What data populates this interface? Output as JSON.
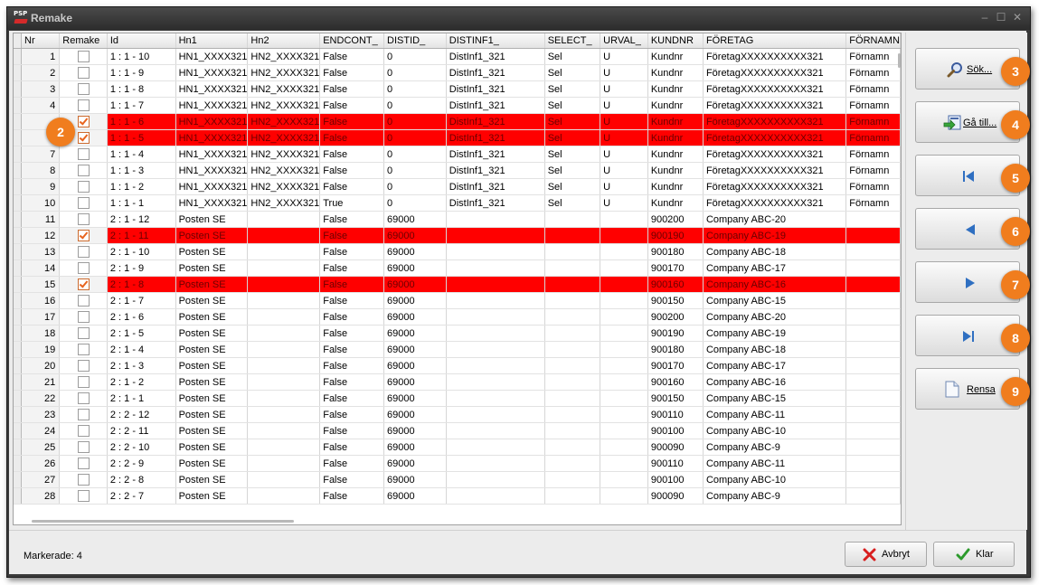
{
  "window": {
    "title": "Remake",
    "app_icon_text": "PSP"
  },
  "grid": {
    "columns": [
      {
        "key": "nr",
        "label": "Nr"
      },
      {
        "key": "remake",
        "label": "Remake"
      },
      {
        "key": "id",
        "label": "Id"
      },
      {
        "key": "hn1",
        "label": "Hn1"
      },
      {
        "key": "hn2",
        "label": "Hn2"
      },
      {
        "key": "endcont",
        "label": "ENDCONT_"
      },
      {
        "key": "distid",
        "label": "DISTID_"
      },
      {
        "key": "distinf1",
        "label": "DISTINF1_"
      },
      {
        "key": "select",
        "label": "SELECT_"
      },
      {
        "key": "urval",
        "label": "URVAL_"
      },
      {
        "key": "kundnr",
        "label": "KUNDNR"
      },
      {
        "key": "foretag",
        "label": "FÖRETAG"
      },
      {
        "key": "fornamn",
        "label": "FÖRNAMN"
      }
    ],
    "rows": [
      {
        "nr": "1",
        "remake": false,
        "id": "1 : 1 - 10",
        "hn1": "HN1_XXXX321",
        "hn2": "HN2_XXXX321",
        "endcont": "False",
        "distid": "0",
        "distinf1": "DistInf1_321",
        "select": "Sel",
        "urval": "U",
        "kundnr": "Kundnr",
        "foretag": "FöretagXXXXXXXXXX321",
        "fornamn": "Förnamn"
      },
      {
        "nr": "2",
        "remake": false,
        "id": "1 : 1 - 9",
        "hn1": "HN1_XXXX321",
        "hn2": "HN2_XXXX321",
        "endcont": "False",
        "distid": "0",
        "distinf1": "DistInf1_321",
        "select": "Sel",
        "urval": "U",
        "kundnr": "Kundnr",
        "foretag": "FöretagXXXXXXXXXX321",
        "fornamn": "Förnamn"
      },
      {
        "nr": "3",
        "remake": false,
        "id": "1 : 1 - 8",
        "hn1": "HN1_XXXX321",
        "hn2": "HN2_XXXX321",
        "endcont": "False",
        "distid": "0",
        "distinf1": "DistInf1_321",
        "select": "Sel",
        "urval": "U",
        "kundnr": "Kundnr",
        "foretag": "FöretagXXXXXXXXXX321",
        "fornamn": "Förnamn"
      },
      {
        "nr": "4",
        "remake": false,
        "id": "1 : 1 - 7",
        "hn1": "HN1_XXXX321",
        "hn2": "HN2_XXXX321",
        "endcont": "False",
        "distid": "0",
        "distinf1": "DistInf1_321",
        "select": "Sel",
        "urval": "U",
        "kundnr": "Kundnr",
        "foretag": "FöretagXXXXXXXXXX321",
        "fornamn": "Förnamn"
      },
      {
        "nr": "",
        "remake": true,
        "id": "1 : 1 - 6",
        "hn1": "HN1_XXXX321",
        "hn2": "HN2_XXXX321",
        "endcont": "False",
        "distid": "0",
        "distinf1": "DistInf1_321",
        "select": "Sel",
        "urval": "U",
        "kundnr": "Kundnr",
        "foretag": "FöretagXXXXXXXXXX321",
        "fornamn": "Förnamn"
      },
      {
        "nr": "",
        "remake": true,
        "id": "1 : 1 - 5",
        "hn1": "HN1_XXXX321",
        "hn2": "HN2_XXXX321",
        "endcont": "False",
        "distid": "0",
        "distinf1": "DistInf1_321",
        "select": "Sel",
        "urval": "U",
        "kundnr": "Kundnr",
        "foretag": "FöretagXXXXXXXXXX321",
        "fornamn": "Förnamn"
      },
      {
        "nr": "7",
        "remake": false,
        "id": "1 : 1 - 4",
        "hn1": "HN1_XXXX321",
        "hn2": "HN2_XXXX321",
        "endcont": "False",
        "distid": "0",
        "distinf1": "DistInf1_321",
        "select": "Sel",
        "urval": "U",
        "kundnr": "Kundnr",
        "foretag": "FöretagXXXXXXXXXX321",
        "fornamn": "Förnamn"
      },
      {
        "nr": "8",
        "remake": false,
        "id": "1 : 1 - 3",
        "hn1": "HN1_XXXX321",
        "hn2": "HN2_XXXX321",
        "endcont": "False",
        "distid": "0",
        "distinf1": "DistInf1_321",
        "select": "Sel",
        "urval": "U",
        "kundnr": "Kundnr",
        "foretag": "FöretagXXXXXXXXXX321",
        "fornamn": "Förnamn"
      },
      {
        "nr": "9",
        "remake": false,
        "id": "1 : 1 - 2",
        "hn1": "HN1_XXXX321",
        "hn2": "HN2_XXXX321",
        "endcont": "False",
        "distid": "0",
        "distinf1": "DistInf1_321",
        "select": "Sel",
        "urval": "U",
        "kundnr": "Kundnr",
        "foretag": "FöretagXXXXXXXXXX321",
        "fornamn": "Förnamn"
      },
      {
        "nr": "10",
        "remake": false,
        "id": "1 : 1 - 1",
        "hn1": "HN1_XXXX321",
        "hn2": "HN2_XXXX321",
        "endcont": "True",
        "distid": "0",
        "distinf1": "DistInf1_321",
        "select": "Sel",
        "urval": "U",
        "kundnr": "Kundnr",
        "foretag": "FöretagXXXXXXXXXX321",
        "fornamn": "Förnamn"
      },
      {
        "nr": "11",
        "remake": false,
        "id": "2 : 1 - 12",
        "hn1": "Posten SE",
        "hn2": "",
        "endcont": "False",
        "distid": "69000",
        "distinf1": "",
        "select": "",
        "urval": "",
        "kundnr": "900200",
        "foretag": "Company  ABC-20",
        "fornamn": ""
      },
      {
        "nr": "12",
        "remake": true,
        "id": "2 : 1 - 11",
        "hn1": "Posten SE",
        "hn2": "",
        "endcont": "False",
        "distid": "69000",
        "distinf1": "",
        "select": "",
        "urval": "",
        "kundnr": "900190",
        "foretag": "Company  ABC-19",
        "fornamn": ""
      },
      {
        "nr": "13",
        "remake": false,
        "id": "2 : 1 - 10",
        "hn1": "Posten SE",
        "hn2": "",
        "endcont": "False",
        "distid": "69000",
        "distinf1": "",
        "select": "",
        "urval": "",
        "kundnr": "900180",
        "foretag": "Company  ABC-18",
        "fornamn": ""
      },
      {
        "nr": "14",
        "remake": false,
        "id": "2 : 1 - 9",
        "hn1": "Posten SE",
        "hn2": "",
        "endcont": "False",
        "distid": "69000",
        "distinf1": "",
        "select": "",
        "urval": "",
        "kundnr": "900170",
        "foretag": "Company  ABC-17",
        "fornamn": ""
      },
      {
        "nr": "15",
        "remake": true,
        "id": "2 : 1 - 8",
        "hn1": "Posten SE",
        "hn2": "",
        "endcont": "False",
        "distid": "69000",
        "distinf1": "",
        "select": "",
        "urval": "",
        "kundnr": "900160",
        "foretag": "Company  ABC-16",
        "fornamn": ""
      },
      {
        "nr": "16",
        "remake": false,
        "id": "2 : 1 - 7",
        "hn1": "Posten SE",
        "hn2": "",
        "endcont": "False",
        "distid": "69000",
        "distinf1": "",
        "select": "",
        "urval": "",
        "kundnr": "900150",
        "foretag": "Company  ABC-15",
        "fornamn": ""
      },
      {
        "nr": "17",
        "remake": false,
        "id": "2 : 1 - 6",
        "hn1": "Posten SE",
        "hn2": "",
        "endcont": "False",
        "distid": "69000",
        "distinf1": "",
        "select": "",
        "urval": "",
        "kundnr": "900200",
        "foretag": "Company  ABC-20",
        "fornamn": ""
      },
      {
        "nr": "18",
        "remake": false,
        "id": "2 : 1 - 5",
        "hn1": "Posten SE",
        "hn2": "",
        "endcont": "False",
        "distid": "69000",
        "distinf1": "",
        "select": "",
        "urval": "",
        "kundnr": "900190",
        "foretag": "Company  ABC-19",
        "fornamn": ""
      },
      {
        "nr": "19",
        "remake": false,
        "id": "2 : 1 - 4",
        "hn1": "Posten SE",
        "hn2": "",
        "endcont": "False",
        "distid": "69000",
        "distinf1": "",
        "select": "",
        "urval": "",
        "kundnr": "900180",
        "foretag": "Company  ABC-18",
        "fornamn": ""
      },
      {
        "nr": "20",
        "remake": false,
        "id": "2 : 1 - 3",
        "hn1": "Posten SE",
        "hn2": "",
        "endcont": "False",
        "distid": "69000",
        "distinf1": "",
        "select": "",
        "urval": "",
        "kundnr": "900170",
        "foretag": "Company  ABC-17",
        "fornamn": ""
      },
      {
        "nr": "21",
        "remake": false,
        "id": "2 : 1 - 2",
        "hn1": "Posten SE",
        "hn2": "",
        "endcont": "False",
        "distid": "69000",
        "distinf1": "",
        "select": "",
        "urval": "",
        "kundnr": "900160",
        "foretag": "Company  ABC-16",
        "fornamn": ""
      },
      {
        "nr": "22",
        "remake": false,
        "id": "2 : 1 - 1",
        "hn1": "Posten SE",
        "hn2": "",
        "endcont": "False",
        "distid": "69000",
        "distinf1": "",
        "select": "",
        "urval": "",
        "kundnr": "900150",
        "foretag": "Company  ABC-15",
        "fornamn": ""
      },
      {
        "nr": "23",
        "remake": false,
        "id": "2 : 2 - 12",
        "hn1": "Posten SE",
        "hn2": "",
        "endcont": "False",
        "distid": "69000",
        "distinf1": "",
        "select": "",
        "urval": "",
        "kundnr": "900110",
        "foretag": "Company  ABC-11",
        "fornamn": ""
      },
      {
        "nr": "24",
        "remake": false,
        "id": "2 : 2 - 11",
        "hn1": "Posten SE",
        "hn2": "",
        "endcont": "False",
        "distid": "69000",
        "distinf1": "",
        "select": "",
        "urval": "",
        "kundnr": "900100",
        "foretag": "Company  ABC-10",
        "fornamn": ""
      },
      {
        "nr": "25",
        "remake": false,
        "id": "2 : 2 - 10",
        "hn1": "Posten SE",
        "hn2": "",
        "endcont": "False",
        "distid": "69000",
        "distinf1": "",
        "select": "",
        "urval": "",
        "kundnr": "900090",
        "foretag": "Company  ABC-9",
        "fornamn": ""
      },
      {
        "nr": "26",
        "remake": false,
        "id": "2 : 2 - 9",
        "hn1": "Posten SE",
        "hn2": "",
        "endcont": "False",
        "distid": "69000",
        "distinf1": "",
        "select": "",
        "urval": "",
        "kundnr": "900110",
        "foretag": "Company  ABC-11",
        "fornamn": ""
      },
      {
        "nr": "27",
        "remake": false,
        "id": "2 : 2 - 8",
        "hn1": "Posten SE",
        "hn2": "",
        "endcont": "False",
        "distid": "69000",
        "distinf1": "",
        "select": "",
        "urval": "",
        "kundnr": "900100",
        "foretag": "Company  ABC-10",
        "fornamn": ""
      },
      {
        "nr": "28",
        "remake": false,
        "id": "2 : 2 - 7",
        "hn1": "Posten SE",
        "hn2": "",
        "endcont": "False",
        "distid": "69000",
        "distinf1": "",
        "select": "",
        "urval": "",
        "kundnr": "900090",
        "foretag": "Company  ABC-9",
        "fornamn": ""
      }
    ]
  },
  "side_buttons": {
    "search": {
      "label": "Sök...",
      "icon": "magnifier-icon",
      "badge": "3"
    },
    "goto": {
      "label": "Gå till...",
      "icon": "goto-icon",
      "badge": "4"
    },
    "first": {
      "icon": "first-record-icon",
      "badge": "5"
    },
    "prev": {
      "icon": "previous-record-icon",
      "badge": "6"
    },
    "next": {
      "icon": "next-record-icon",
      "badge": "7"
    },
    "last": {
      "icon": "last-record-icon",
      "badge": "8"
    },
    "clear": {
      "label": "Rensa",
      "icon": "document-icon",
      "badge": "9"
    }
  },
  "grid_badge": "2",
  "status": {
    "text": "Markerade: 4"
  },
  "footer": {
    "cancel_label": "Avbryt",
    "ok_label": "Klar"
  },
  "colors": {
    "selected_row": "#ff0000",
    "badge": "#f07d1e"
  }
}
